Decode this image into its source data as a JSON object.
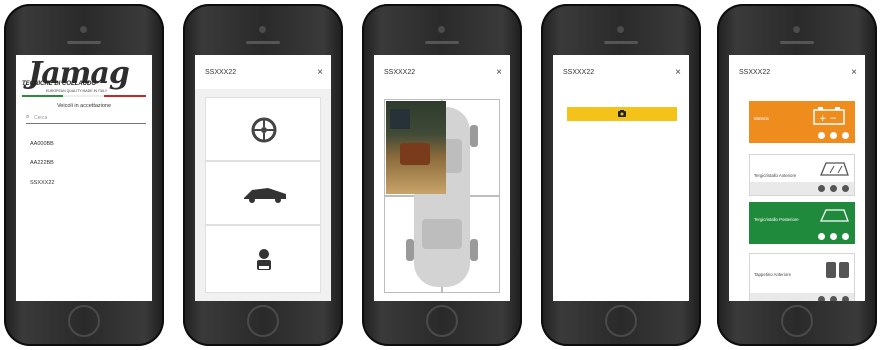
{
  "screen1": {
    "logo_word": "Jamag",
    "logo_sub": "TECNICHE DI COLLAUDO",
    "logo_tag": "EUROPEAN QUALITY MADE IN ITALY",
    "list_title": "Veicoli in accettazione",
    "search_placeholder": "Cerca",
    "plates": [
      "AA000BB",
      "AA222BB",
      "SSXXX22"
    ]
  },
  "screen2": {
    "title": "SSXXX22",
    "close": "×"
  },
  "screen3": {
    "title": "SSXXX22",
    "close": "×"
  },
  "screen4": {
    "title": "SSXXX22",
    "close": "×",
    "camera_icon": "camera-icon"
  },
  "screen5": {
    "title": "SSXXX22",
    "close": "×",
    "tiles": [
      {
        "label": "Batteria",
        "color": "#ef8c1e",
        "icon": "battery-icon"
      },
      {
        "label": "Tergicristallo Anteriore",
        "color": "#ffffff",
        "icon": "windshield-icon"
      },
      {
        "label": "Tergicristallo Posteriore",
        "color": "#1f8a3c",
        "icon": "rear-window-icon"
      },
      {
        "label": "Tappetino Anteriore",
        "color": "#ffffff",
        "icon": "floor-mat-icon"
      }
    ]
  },
  "colors": {
    "accent_yellow": "#f4c31a",
    "battery_orange": "#ef8c1e",
    "green": "#1f8a3c"
  }
}
